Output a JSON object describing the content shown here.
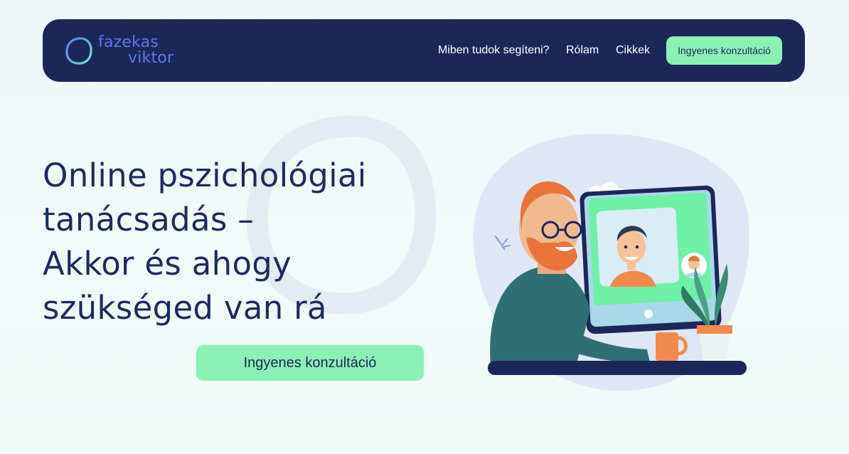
{
  "brand": {
    "word1": "fazekas",
    "word2": "viktor"
  },
  "nav": {
    "items": [
      {
        "label": "Miben tudok segíteni?"
      },
      {
        "label": "Rólam"
      },
      {
        "label": "Cikkek"
      }
    ],
    "cta_label": "Ingyenes konzultáció"
  },
  "hero": {
    "title_lines": [
      "Online pszichológiai",
      "tanácsadás –",
      "Akkor és ahogy",
      "szükséged van rá"
    ],
    "cta_label": "Ingyenes konzultáció"
  },
  "colors": {
    "navy": "#1c2759",
    "accent_green": "#8bf0b4",
    "logo_blue": "#5b78e6",
    "heading": "#1c2a66"
  },
  "icons": [
    "logo-ring-icon"
  ]
}
